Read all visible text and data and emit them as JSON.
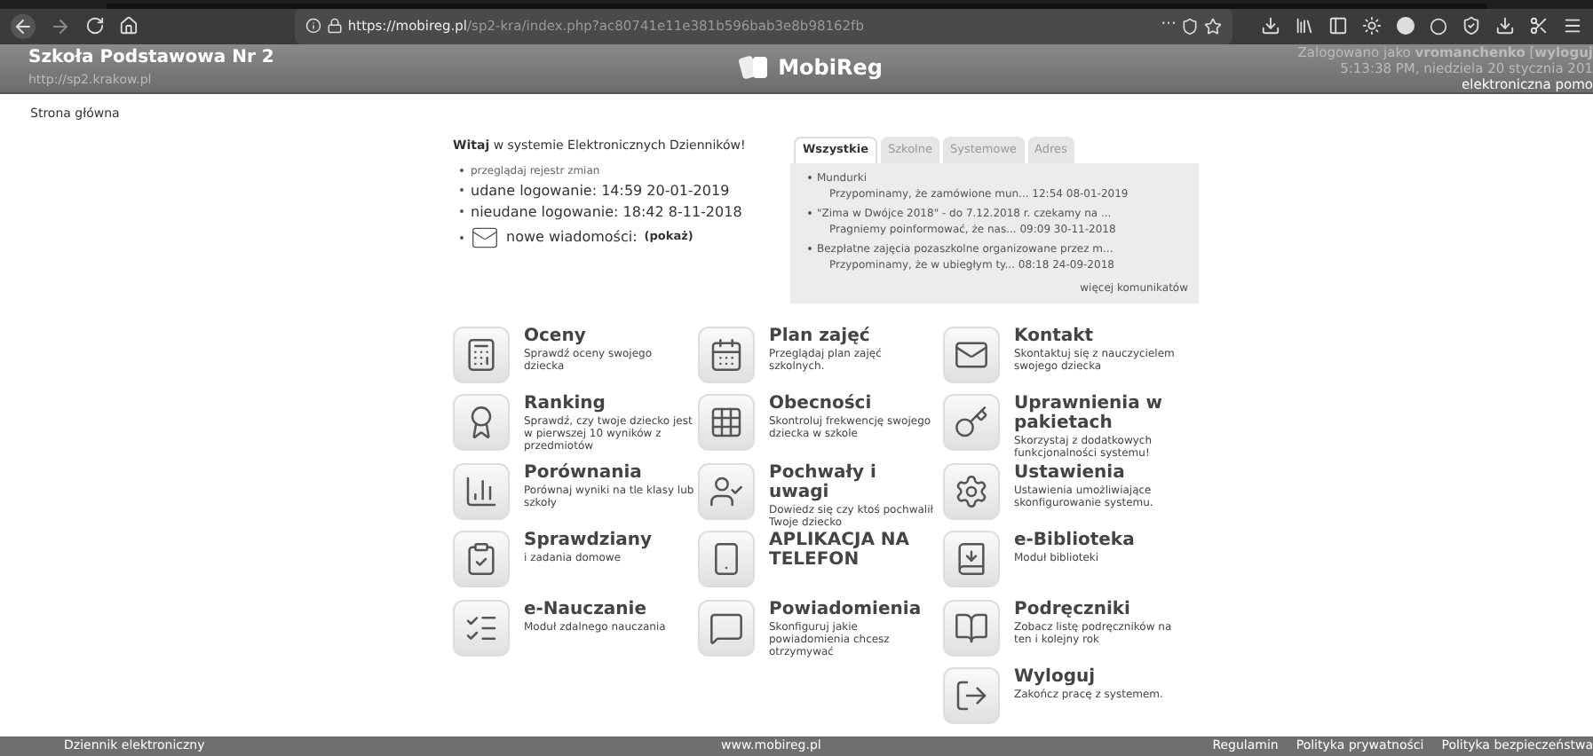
{
  "browser": {
    "url_host": "https://mobireg.pl",
    "url_path": "/sp2-kra/index.php?ac80741e11e381b596bab3e8b98162fb",
    "menu_dots": "···"
  },
  "header": {
    "school": "Szkoła Podstawowa Nr 2",
    "school_url": "http://sp2.krakow.pl",
    "logo": "MobiReg",
    "user_line": "Zalogowano jako **vromanchenko** [**wyloguj**",
    "datetime": "5:13:38 PM, niedziela 20 stycznia 201",
    "help": "elektroniczna pomo"
  },
  "breadcrumb": "Strona główna",
  "welcome": {
    "title": "**Witaj** w systemie Elektronicznych Dzienników!",
    "items": [
      {
        "kind": "link",
        "text": "przeglądaj rejestr zmian"
      },
      {
        "kind": "text",
        "text": "udane logowanie: 14:59 20-01-2019"
      },
      {
        "kind": "text",
        "text": "nieudane logowanie: 18:42 8-11-2018"
      },
      {
        "kind": "mail",
        "text": "nowe wiadomości:",
        "link": "(pokaż)"
      }
    ]
  },
  "messages": {
    "tabs": [
      {
        "label": "Wszystkie",
        "selected": true
      },
      {
        "label": "Szkolne",
        "selected": false
      },
      {
        "label": "Systemowe",
        "selected": false
      },
      {
        "label": "Adres",
        "selected": false
      }
    ],
    "items": [
      {
        "title": "Mundurki",
        "body": "Przypominamy, że zamówione mun... 12:54 08-01-2019"
      },
      {
        "title": "\"Zima w Dwójce 2018\" - do 7.12.2018 r. czekamy na ...",
        "body": "Pragniemy poinformować, że nas... 09:09 30-11-2018"
      },
      {
        "title": "Bezpłatne zajęcia pozaszkolne organizowane przez m...",
        "body": "Przypominamy, że w ubiegłym ty... 08:18 24-09-2018"
      }
    ],
    "more": "więcej komunikatów"
  },
  "modules": [
    [
      {
        "title": "Oceny",
        "desc": "Sprawdź oceny swojego dziecka"
      },
      {
        "title": "Ranking",
        "desc": "Sprawdź, czy twoje dziecko jest w pierwszej 10 wyników z przedmiotów"
      },
      {
        "title": "Porównania",
        "desc": "Porównaj wyniki na tle klasy lub szkoły"
      },
      {
        "title": "Sprawdziany",
        "desc": "i zadania domowe"
      },
      {
        "title": "e-Nauczanie",
        "desc": "Moduł zdalnego nauczania"
      }
    ],
    [
      {
        "title": "Plan zajęć",
        "desc": "Przeglądaj plan zajęć szkolnych."
      },
      {
        "title": "Obecności",
        "desc": "Skontroluj frekwencję swojego dziecka w szkole"
      },
      {
        "title": "Pochwały i uwagi",
        "desc": "Dowiedz się czy ktoś pochwalił Twoje dziecko"
      },
      {
        "title": "APLIKACJA NA TELEFON"
      },
      {
        "title": "Powiadomienia",
        "desc": "Skonfiguruj jakie powiadomienia chcesz otrzymywać"
      }
    ],
    [
      {
        "title": "Kontakt",
        "desc": "Skontaktuj się z nauczycielem swojego dziecka"
      },
      {
        "title": "Uprawnienia w pakietach",
        "desc": "Skorzystaj z dodatkowych funkcjonalności systemu!"
      },
      {
        "title": "Ustawienia",
        "desc": "Ustawienia umożliwiające skonfigurowanie systemu."
      },
      {
        "title": "e-Biblioteka",
        "desc": "Moduł biblioteki"
      },
      {
        "title": "Podręczniki",
        "desc": "Zobacz listę podręczników na ten i kolejny rok"
      },
      {
        "title": "Wyloguj",
        "desc": "Zakończ pracę z systemem."
      }
    ]
  ],
  "footer": {
    "left": "Dziennik elektroniczny",
    "center": "www.mobireg.pl",
    "links": [
      "Regulamin",
      "Polityka prywatności",
      "Polityka bezpieczeństwa"
    ]
  }
}
